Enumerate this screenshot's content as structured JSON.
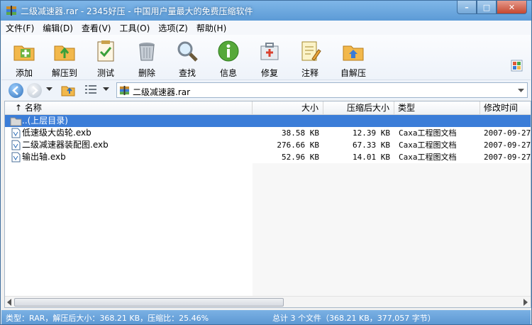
{
  "window": {
    "title": "二级减速器.rar - 2345好压 - 中国用户量最大的免费压缩软件",
    "controls": {
      "minimize": "–",
      "maximize": "□",
      "close": "✕"
    }
  },
  "menu": [
    "文件(F)",
    "编辑(D)",
    "查看(V)",
    "工具(O)",
    "选项(Z)",
    "帮助(H)"
  ],
  "toolbar": [
    {
      "label": "添加",
      "icon": "add-archive-icon"
    },
    {
      "label": "解压到",
      "icon": "extract-to-icon"
    },
    {
      "label": "测试",
      "icon": "test-icon"
    },
    {
      "label": "删除",
      "icon": "delete-icon"
    },
    {
      "label": "查找",
      "icon": "find-icon"
    },
    {
      "label": "信息",
      "icon": "info-icon"
    },
    {
      "label": "修复",
      "icon": "repair-icon"
    },
    {
      "label": "注释",
      "icon": "comment-icon"
    },
    {
      "label": "自解压",
      "icon": "sfx-icon"
    }
  ],
  "address": {
    "path": "二级减速器.rar"
  },
  "columns": {
    "name": "名称",
    "size": "大小",
    "packed": "压缩后大小",
    "type": "类型",
    "modified": "修改时间"
  },
  "rows": [
    {
      "name": "..(上层目录)",
      "size": "",
      "packed": "",
      "type": "",
      "modified": "",
      "selected": true,
      "kind": "folder"
    },
    {
      "name": "低速级大齿轮.exb",
      "size": "38.58 KB",
      "packed": "12.39 KB",
      "type": "Caxa工程图文档",
      "modified": "2007-09-27",
      "kind": "file"
    },
    {
      "name": "二级减速器装配图.exb",
      "size": "276.66 KB",
      "packed": "67.33 KB",
      "type": "Caxa工程图文档",
      "modified": "2007-09-27",
      "kind": "file"
    },
    {
      "name": "输出轴.exb",
      "size": "52.96 KB",
      "packed": "14.01 KB",
      "type": "Caxa工程图文档",
      "modified": "2007-09-27",
      "kind": "file"
    }
  ],
  "status": {
    "left": "类型：RAR，解压后大小：368.21 KB，压缩比：25.46%",
    "right": "总计 3 个文件（368.21 KB，377,057 字节）"
  },
  "colors": {
    "accent": "#3b7dd8",
    "titlebar": "#5c9bd6"
  }
}
